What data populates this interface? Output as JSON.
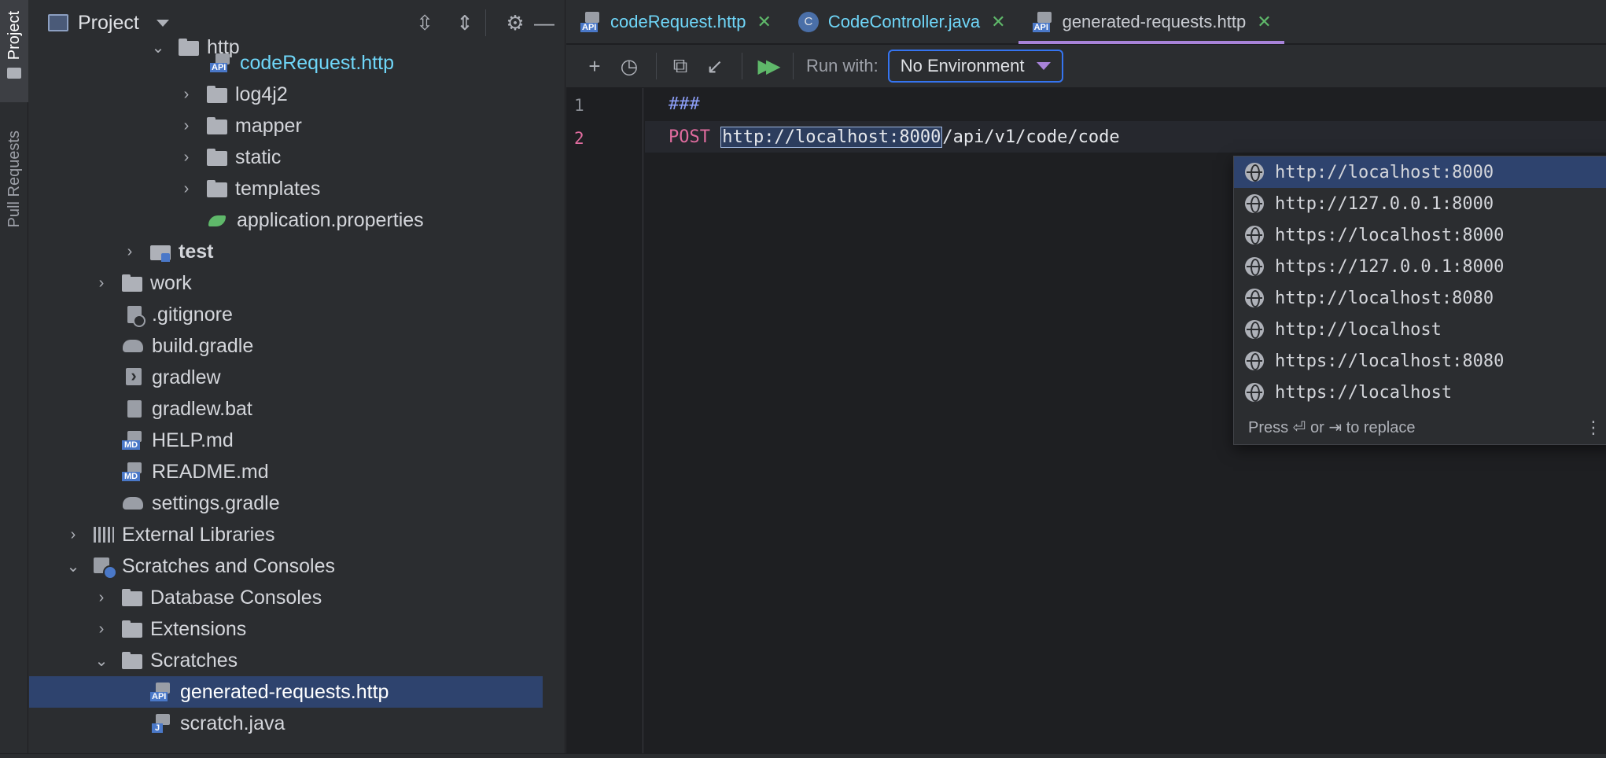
{
  "sidebar_strip": {
    "project_tab": "Project",
    "pull_requests_tab": "Pull Requests"
  },
  "project_panel": {
    "title": "Project",
    "header_icons": [
      "expand-all-icon",
      "collapse-all-icon",
      "gear-icon",
      "minimize-icon"
    ],
    "tree": [
      {
        "label": "http",
        "icon": "folder",
        "expanded": true
      },
      {
        "label": "codeRequest.http",
        "icon": "api-file"
      },
      {
        "label": "log4j2",
        "icon": "folder",
        "expanded": false
      },
      {
        "label": "mapper",
        "icon": "folder",
        "expanded": false
      },
      {
        "label": "static",
        "icon": "folder",
        "expanded": false
      },
      {
        "label": "templates",
        "icon": "folder",
        "expanded": false
      },
      {
        "label": "application.properties",
        "icon": "properties-file"
      },
      {
        "label": "test",
        "icon": "test-folder",
        "expanded": false
      },
      {
        "label": "work",
        "icon": "folder",
        "expanded": false
      },
      {
        "label": ".gitignore",
        "icon": "gitignore-file"
      },
      {
        "label": "build.gradle",
        "icon": "gradle-file"
      },
      {
        "label": "gradlew",
        "icon": "shell-file"
      },
      {
        "label": "gradlew.bat",
        "icon": "text-file"
      },
      {
        "label": "HELP.md",
        "icon": "markdown-file"
      },
      {
        "label": "README.md",
        "icon": "markdown-file"
      },
      {
        "label": "settings.gradle",
        "icon": "gradle-file"
      },
      {
        "label": "External Libraries",
        "icon": "libraries",
        "expanded": false
      },
      {
        "label": "Scratches and Consoles",
        "icon": "scratches",
        "expanded": true
      },
      {
        "label": "Database Consoles",
        "icon": "folder",
        "expanded": false
      },
      {
        "label": "Extensions",
        "icon": "folder",
        "expanded": false
      },
      {
        "label": "Scratches",
        "icon": "folder",
        "expanded": true
      },
      {
        "label": "generated-requests.http",
        "icon": "api-scratch-file",
        "selected": true
      },
      {
        "label": "scratch.java",
        "icon": "java-scratch-file"
      }
    ]
  },
  "editor": {
    "tabs": [
      {
        "label": "codeRequest.http",
        "icon": "api-file-icon",
        "active": false
      },
      {
        "label": "CodeController.java",
        "icon": "class-icon",
        "active": false
      },
      {
        "label": "generated-requests.http",
        "icon": "api-file-icon",
        "active": true
      }
    ],
    "toolbar": {
      "icons": [
        "add-icon",
        "history-icon",
        "copy-icon",
        "import-icon",
        "run-all-icon"
      ],
      "run_with_label": "Run with:",
      "environment_value": "No Environment"
    },
    "line_numbers": [
      "1",
      "2"
    ],
    "lines": {
      "line1": "###",
      "line2_method": "POST",
      "line2_url_selected": "http://localhost:8000",
      "line2_url_rest": "/api/v1/code/code"
    },
    "completion_popup": {
      "items": [
        "http://localhost:8000",
        "http://127.0.0.1:8000",
        "https://localhost:8000",
        "https://127.0.0.1:8000",
        "http://localhost:8080",
        "http://localhost",
        "https://localhost:8080",
        "https://localhost"
      ],
      "selected_index": 0,
      "footer": "Press ⏎ or ⇥ to replace"
    }
  },
  "colors": {
    "background": "#1e1f22",
    "panel": "#2b2d30",
    "selection": "#2e436e",
    "accent": "#a883d9",
    "link": "#6fd6f8",
    "run_green": "#5fb86a",
    "method_pink": "#e06c9f"
  }
}
